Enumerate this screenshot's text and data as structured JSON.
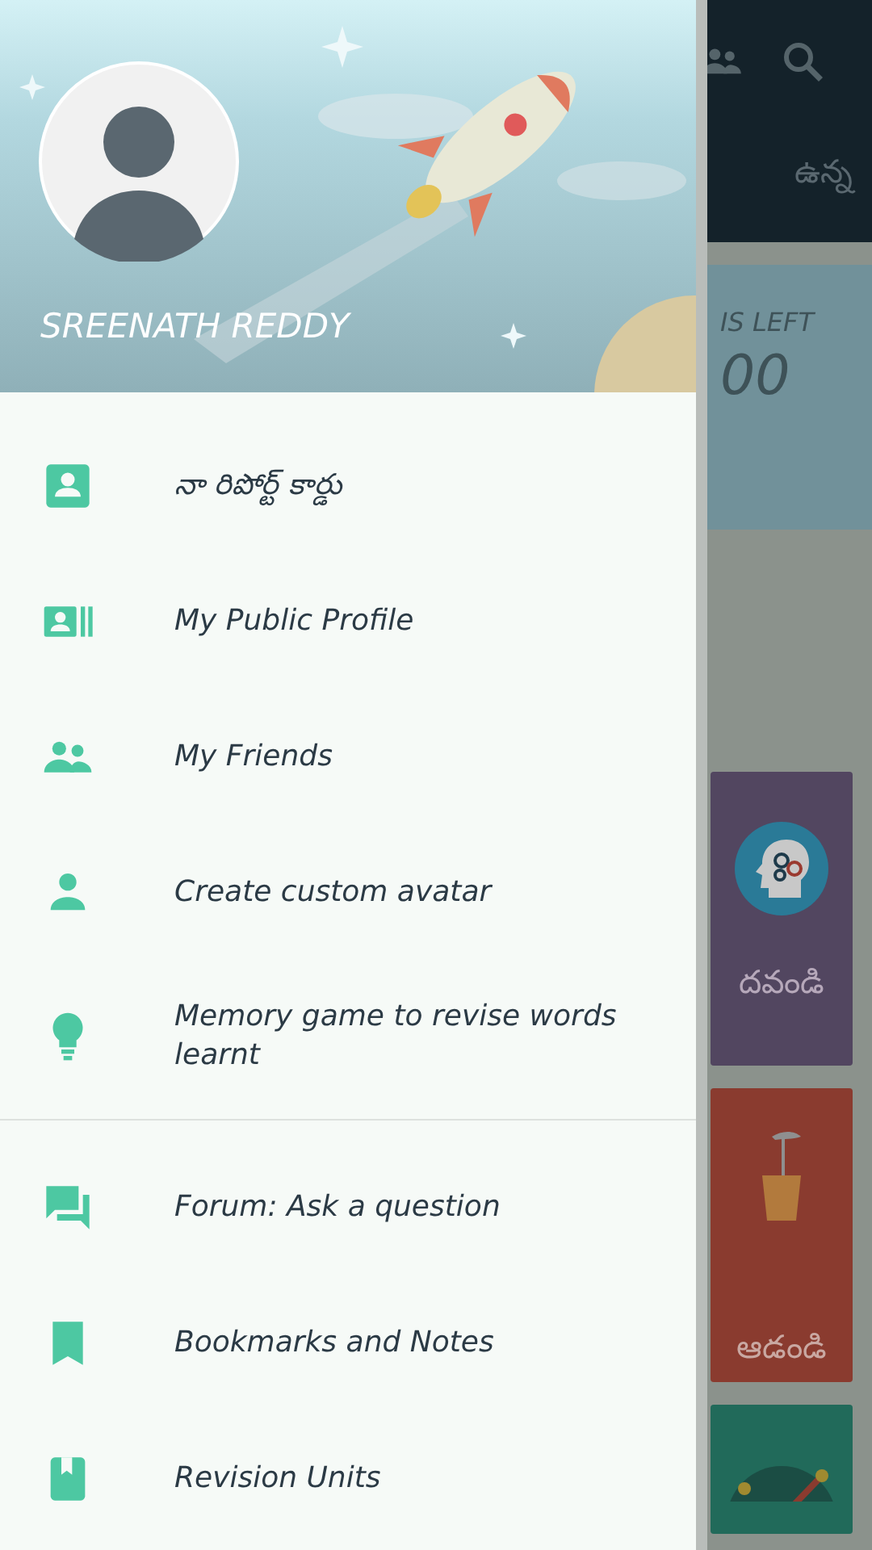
{
  "background_screen": {
    "top_bar": {
      "tab_text": "ఉన్న"
    },
    "banner": {
      "label": "IS LEFT",
      "value": "00"
    },
    "cards": [
      {
        "kind": "head",
        "label": "దవండి",
        "color": "#524660"
      },
      {
        "kind": "glass",
        "label": "ఆడండి",
        "color": "#8a3b2f"
      },
      {
        "kind": "dial",
        "color": "#216a5a"
      }
    ]
  },
  "drawer": {
    "user_name": "SREENATH REDDY",
    "sections": [
      [
        {
          "kind": "contact",
          "label": "నా రిపోర్ట్ కార్డు"
        },
        {
          "kind": "profile",
          "label": "My Public Profile"
        },
        {
          "kind": "friends",
          "label": "My Friends"
        },
        {
          "kind": "person",
          "label": "Create custom avatar"
        },
        {
          "kind": "bulb",
          "label": "Memory game to revise words learnt"
        }
      ],
      [
        {
          "kind": "forum",
          "label": "Forum: Ask a question"
        },
        {
          "kind": "bookmark",
          "label": "Bookmarks and Notes"
        },
        {
          "kind": "book",
          "label": "Revision Units"
        }
      ]
    ]
  }
}
